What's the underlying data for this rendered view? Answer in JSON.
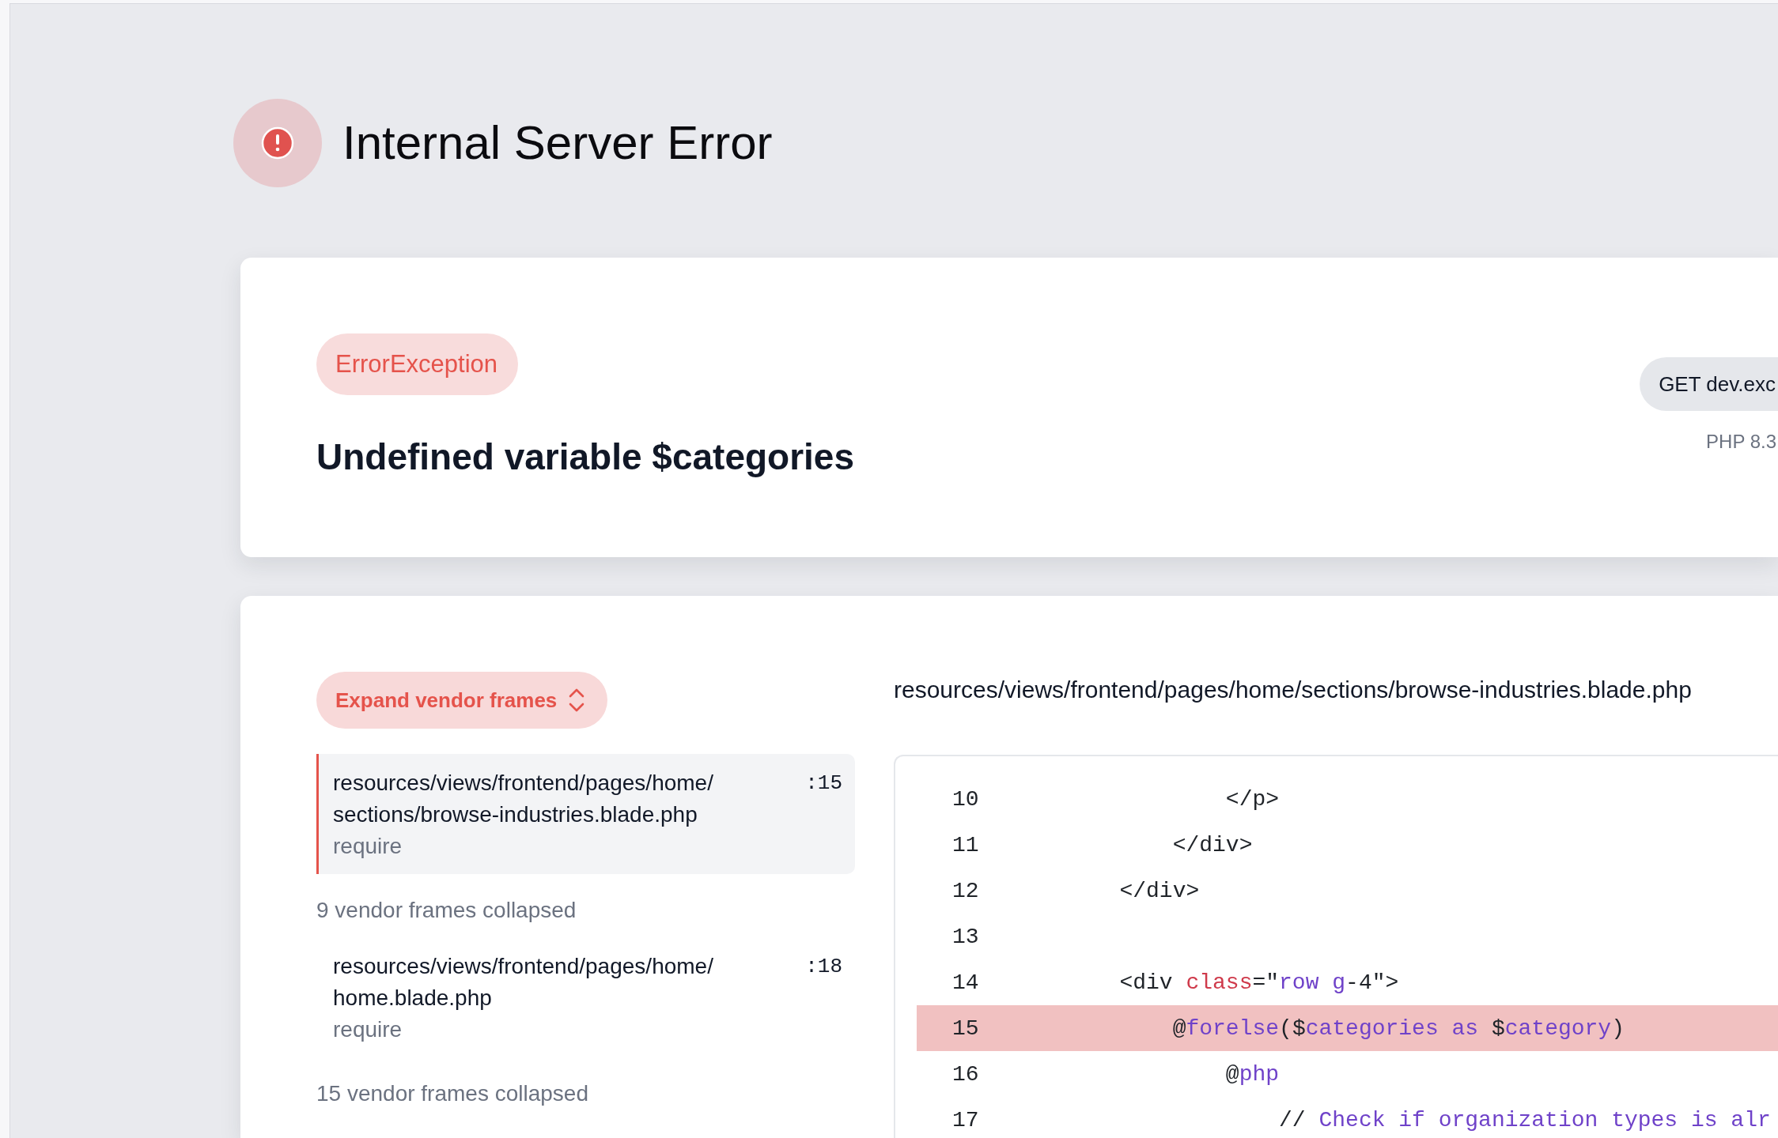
{
  "header": {
    "title": "Internal Server Error"
  },
  "exception": {
    "type": "ErrorException",
    "message": "Undefined variable $categories",
    "request": "GET dev.exc",
    "php_version": "PHP 8.3"
  },
  "stack": {
    "expand_button": "Expand vendor frames",
    "frames": [
      {
        "kind": "frame",
        "file": "resources/views/frontend/pages/home/sections/browse-industries.blade.php",
        "line": ":15",
        "function": "require",
        "selected": true
      },
      {
        "kind": "collapsed",
        "label": "9 vendor frames collapsed"
      },
      {
        "kind": "frame",
        "file": "resources/views/frontend/pages/home/home.blade.php",
        "line": ":18",
        "function": "require",
        "selected": false
      },
      {
        "kind": "collapsed",
        "label": "15 vendor frames collapsed"
      }
    ]
  },
  "code": {
    "file": "resources/views/frontend/pages/home/sections/browse-industries.blade.php",
    "lines": [
      {
        "number": "10",
        "highlighted": false,
        "tokens": [
          {
            "kind": "plain",
            "text": "                </p>"
          }
        ]
      },
      {
        "number": "11",
        "highlighted": false,
        "tokens": [
          {
            "kind": "plain",
            "text": "            </div>"
          }
        ]
      },
      {
        "number": "12",
        "highlighted": false,
        "tokens": [
          {
            "kind": "plain",
            "text": "        </div>"
          }
        ]
      },
      {
        "number": "13",
        "highlighted": false
      },
      {
        "number": "14",
        "highlighted": false,
        "tokens": [
          {
            "kind": "plain",
            "text": "        <div "
          },
          {
            "kind": "attribute",
            "text": "class"
          },
          {
            "kind": "plain",
            "text": "=\""
          },
          {
            "kind": "keyword",
            "text": "row g"
          },
          {
            "kind": "plain",
            "text": "-4\">"
          }
        ]
      },
      {
        "number": "15",
        "highlighted": true,
        "tokens": [
          {
            "kind": "plain",
            "text": "            @"
          },
          {
            "kind": "keyword",
            "text": "forelse"
          },
          {
            "kind": "plain",
            "text": "($"
          },
          {
            "kind": "keyword",
            "text": "categories as"
          },
          {
            "kind": "plain",
            "text": " $"
          },
          {
            "kind": "keyword",
            "text": "category"
          },
          {
            "kind": "plain",
            "text": ")"
          }
        ]
      },
      {
        "number": "16",
        "highlighted": false,
        "tokens": [
          {
            "kind": "plain",
            "text": "                @"
          },
          {
            "kind": "keyword",
            "text": "php"
          }
        ]
      },
      {
        "number": "17",
        "highlighted": false,
        "tokens": [
          {
            "kind": "plain",
            "text": "                    //"
          },
          {
            "kind": "comment",
            "text": " Check if organization types is alr"
          }
        ]
      }
    ]
  }
}
